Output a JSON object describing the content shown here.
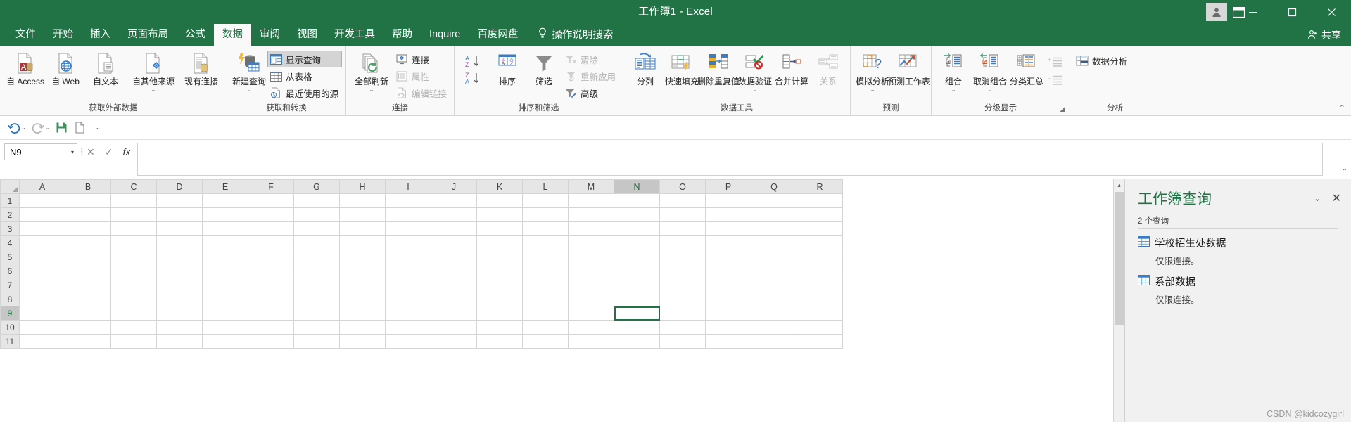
{
  "titlebar": {
    "title": "工作簿1  -  Excel",
    "account_icon": "user-account-icon",
    "ribbon_display_icon": "ribbon-display-options-icon",
    "minimize": "–",
    "restore": "❐",
    "close": "✕"
  },
  "tabs": [
    {
      "label": "文件",
      "active": false
    },
    {
      "label": "开始",
      "active": false
    },
    {
      "label": "插入",
      "active": false
    },
    {
      "label": "页面布局",
      "active": false
    },
    {
      "label": "公式",
      "active": false
    },
    {
      "label": "数据",
      "active": true
    },
    {
      "label": "审阅",
      "active": false
    },
    {
      "label": "视图",
      "active": false
    },
    {
      "label": "开发工具",
      "active": false
    },
    {
      "label": "帮助",
      "active": false
    },
    {
      "label": "Inquire",
      "active": false
    },
    {
      "label": "百度网盘",
      "active": false
    }
  ],
  "tellme": {
    "label": "操作说明搜索",
    "icon": "lightbulb-icon"
  },
  "share": {
    "label": "共享",
    "icon": "share-person-icon"
  },
  "ribbon": {
    "groups": [
      {
        "name": "获取外部数据",
        "label": "获取外部数据",
        "big_buttons": [
          {
            "label": "自 Access",
            "icon": "access-db-icon",
            "caret": false,
            "disabled": false
          },
          {
            "label": "自 Web",
            "icon": "web-globe-icon",
            "caret": false,
            "disabled": false
          },
          {
            "label": "自文本",
            "icon": "text-file-icon",
            "caret": false,
            "disabled": false
          },
          {
            "label": "自其他来源",
            "icon": "other-sources-icon",
            "caret": true,
            "disabled": false
          },
          {
            "label": "现有连接",
            "icon": "existing-connections-icon",
            "caret": false,
            "disabled": false
          }
        ]
      },
      {
        "name": "获取和转换",
        "label": "获取和转换",
        "big_buttons": [
          {
            "label": "新建查询",
            "icon": "new-query-icon",
            "caret": true,
            "disabled": false
          }
        ],
        "small_buttons": [
          {
            "label": "显示查询",
            "icon": "show-queries-icon",
            "pressed": true,
            "disabled": false
          },
          {
            "label": "从表格",
            "icon": "from-table-icon",
            "pressed": false,
            "disabled": false
          },
          {
            "label": "最近使用的源",
            "icon": "recent-sources-icon",
            "pressed": false,
            "disabled": false
          }
        ]
      },
      {
        "name": "连接",
        "label": "连接",
        "big_buttons": [
          {
            "label": "全部刷新",
            "icon": "refresh-all-icon",
            "caret": true,
            "disabled": false
          }
        ],
        "small_buttons": [
          {
            "label": "连接",
            "icon": "connections-icon",
            "pressed": false,
            "disabled": false
          },
          {
            "label": "属性",
            "icon": "properties-icon",
            "pressed": false,
            "disabled": true
          },
          {
            "label": "编辑链接",
            "icon": "edit-links-icon",
            "pressed": false,
            "disabled": true
          }
        ]
      },
      {
        "name": "排序和筛选",
        "label": "排序和筛选",
        "sort_small": [
          {
            "label": "",
            "icon": "sort-a-to-z-icon",
            "disabled": false
          },
          {
            "label": "",
            "icon": "sort-z-to-a-icon",
            "disabled": false
          }
        ],
        "big_buttons": [
          {
            "label": "排序",
            "icon": "sort-dialog-icon",
            "caret": false,
            "disabled": false
          },
          {
            "label": "筛选",
            "icon": "filter-funnel-icon",
            "caret": false,
            "disabled": false
          }
        ],
        "small_buttons": [
          {
            "label": "清除",
            "icon": "clear-filter-icon",
            "pressed": false,
            "disabled": true
          },
          {
            "label": "重新应用",
            "icon": "reapply-filter-icon",
            "pressed": false,
            "disabled": true
          },
          {
            "label": "高级",
            "icon": "advanced-filter-icon",
            "pressed": false,
            "disabled": false
          }
        ]
      },
      {
        "name": "数据工具",
        "label": "数据工具",
        "big_buttons": [
          {
            "label": "分列",
            "icon": "text-to-columns-icon",
            "caret": false,
            "disabled": false
          },
          {
            "label": "快速填充",
            "icon": "flash-fill-icon",
            "caret": false,
            "disabled": false
          },
          {
            "label": "删除重复值",
            "icon": "remove-duplicates-icon",
            "caret": false,
            "disabled": false
          },
          {
            "label": "数据验证",
            "icon": "data-validation-icon",
            "caret": true,
            "disabled": false
          },
          {
            "label": "合并计算",
            "icon": "consolidate-icon",
            "caret": false,
            "disabled": false
          },
          {
            "label": "关系",
            "icon": "relationships-icon",
            "caret": false,
            "disabled": true
          }
        ]
      },
      {
        "name": "预测",
        "label": "预测",
        "big_buttons": [
          {
            "label": "模拟分析",
            "icon": "what-if-analysis-icon",
            "caret": true,
            "disabled": false
          },
          {
            "label": "预测工作表",
            "icon": "forecast-sheet-icon",
            "caret": false,
            "disabled": false
          }
        ]
      },
      {
        "name": "分级显示",
        "label": "分级显示",
        "big_buttons": [
          {
            "label": "组合",
            "icon": "group-icon",
            "caret": true,
            "disabled": false
          },
          {
            "label": "取消组合",
            "icon": "ungroup-icon",
            "caret": true,
            "disabled": false
          },
          {
            "label": "分类汇总",
            "icon": "subtotal-icon",
            "caret": false,
            "disabled": false
          }
        ],
        "small_buttons": [
          {
            "label": "",
            "icon": "show-detail-icon",
            "pressed": false,
            "disabled": true
          },
          {
            "label": "",
            "icon": "hide-detail-icon",
            "pressed": false,
            "disabled": true
          }
        ],
        "dialog_launcher": "◢"
      },
      {
        "name": "分析",
        "label": "分析",
        "small_buttons": [
          {
            "label": "数据分析",
            "icon": "data-analysis-icon",
            "pressed": false,
            "disabled": false
          }
        ]
      }
    ],
    "collapse_icon": "collapse-ribbon-icon"
  },
  "qat": {
    "buttons": [
      {
        "name": "undo",
        "icon": "undo-arrow-icon",
        "caret": true
      },
      {
        "name": "redo",
        "icon": "redo-arrow-icon",
        "caret": true
      },
      {
        "name": "save",
        "icon": "save-disk-icon",
        "caret": false
      },
      {
        "name": "new",
        "icon": "new-document-icon",
        "caret": false
      },
      {
        "name": "customize",
        "icon": "chevron-down-icon",
        "caret": false
      }
    ]
  },
  "formula_bar": {
    "name_box_value": "N9",
    "name_box_caret": "▾",
    "cancel_icon": "cancel-x-icon",
    "enter_icon": "confirm-check-icon",
    "function_icon": "fx",
    "input_value": "",
    "input_placeholder": "",
    "expand_icon": "expand-formula-bar-icon"
  },
  "grid": {
    "columns": [
      "A",
      "B",
      "C",
      "D",
      "E",
      "F",
      "G",
      "H",
      "I",
      "J",
      "K",
      "L",
      "M",
      "N",
      "O",
      "P",
      "Q",
      "R"
    ],
    "rows": [
      "1",
      "2",
      "3",
      "4",
      "5",
      "6",
      "7",
      "8",
      "9",
      "10",
      "11"
    ],
    "selected_column": "N",
    "selected_row": "9",
    "active_cell": "N9",
    "scrollbar": {
      "up_arrow": "▴",
      "down_arrow": "▾"
    }
  },
  "queries_pane": {
    "title": "工作簿查询",
    "caret_icon": "chevron-down-icon",
    "close_icon": "close-icon",
    "count_label": "2 个查询",
    "items": [
      {
        "name": "学校招生处数据",
        "status": "仅限连接。",
        "icon": "query-table-icon"
      },
      {
        "name": "系部数据",
        "status": "仅限连接。",
        "icon": "query-table-icon"
      }
    ]
  },
  "watermark": "CSDN @kidcozygirl",
  "colors": {
    "excel_green": "#217346",
    "ribbon_bg": "#f9f9f9",
    "pane_bg": "#f1f1f1",
    "header_gray": "#e6e6e6",
    "selected_header": "#c6c6c6"
  }
}
